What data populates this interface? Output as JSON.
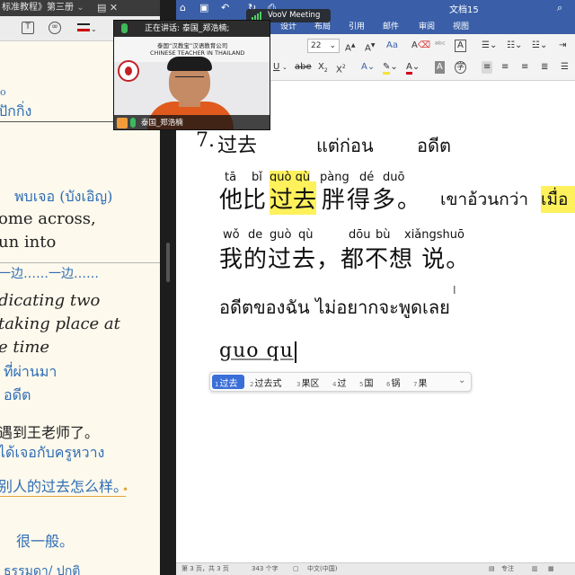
{
  "left_pane": {
    "title": "标准教程》第三册",
    "thai_partial": "ปักกิ่ง",
    "vocab_thai": "พบเจอ (บังเอิญ)",
    "vocab_en1": "ome across,",
    "vocab_en2": "un into",
    "dots_phrase": "一边……一边……",
    "indicating": "dicating two",
    "taking_place": "taking place at",
    "same_time": "e time",
    "past_thai": "ที่ผ่านมา",
    "past_thai2": "อดีต",
    "sentence_cn": "遇到王老师了。",
    "sentence_thai": "ได้เจอกับครูหวาง",
    "sentence2_cn": "别人的过去怎么样。",
    "general": "很一般。",
    "bottom_thai": "ธรรมดา/ ปกติ"
  },
  "word": {
    "window_title": "文档15",
    "tabs": [
      "设计",
      "布局",
      "引用",
      "邮件",
      "审阅",
      "视图"
    ],
    "font_size": "22",
    "doc": {
      "heading_num": "7.",
      "heading_cn": "过去",
      "heading_thai1": "แต่ก่อน",
      "heading_thai2": "อดีต",
      "py1_a": "tā",
      "py1_b": "bǐ",
      "py1_c": "guò qù",
      "py1_d": "pàng",
      "py1_e": "dé",
      "py1_f": "duō",
      "s1_a": "他比",
      "s1_hl": "过去",
      "s1_b": "胖得多。",
      "s1_thai": "เขาอ้วนกว่า",
      "s1_thai_hl": "เมื่อ",
      "py2_a": "wǒ",
      "py2_b": "de",
      "py2_c": "guò",
      "py2_d": "qù",
      "py2_e": "dōu",
      "py2_f": "bù",
      "py2_g": "xiǎngshuō",
      "s2": "我的过去，都不想 说。",
      "s2_thai": "อดีตของฉัน ไม่อยากจะพูดเลย",
      "typing": "guo qu"
    },
    "ime": [
      {
        "n": "1",
        "w": "过去"
      },
      {
        "n": "2",
        "w": "过去式"
      },
      {
        "n": "3",
        "w": "果区"
      },
      {
        "n": "4",
        "w": "过"
      },
      {
        "n": "5",
        "w": "国"
      },
      {
        "n": "6",
        "w": "锅"
      },
      {
        "n": "7",
        "w": "果"
      }
    ],
    "status": {
      "page": "第 3 页，共 3 页",
      "words": "343 个字",
      "lang": "中文(中国)",
      "focus": "专注"
    }
  },
  "video": {
    "speaking_label": "正在讲话: 泰国_郑浩楠;",
    "banner_cn": "泰国“汉教宝”汉语教育公司",
    "banner_en": "CHINESE TEACHER IN THAILAND",
    "name": "泰国_郑浩楠",
    "app": "VooV Meeting"
  }
}
